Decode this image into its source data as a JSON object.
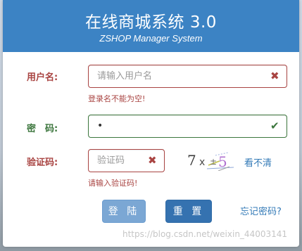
{
  "header": {
    "title": "在线商城系统 3.0",
    "subtitle": "ZSHOP Manager System"
  },
  "form": {
    "username": {
      "label": "用户名:",
      "placeholder": "请输入用户名",
      "value": "",
      "status": "error",
      "icon": "close-icon",
      "error_text": "登录名不能为空!"
    },
    "password": {
      "label": "密　码:",
      "placeholder": "",
      "value": "•",
      "status": "success",
      "icon": "check-icon"
    },
    "captcha": {
      "label": "验证码:",
      "placeholder": "验证码",
      "value": "",
      "status": "error",
      "icon": "close-icon",
      "error_text": "请输入验证码!",
      "refresh_link": "看不清"
    }
  },
  "buttons": {
    "login": "登 陆",
    "reset": "重 置",
    "forgot": "忘记密码?"
  },
  "watermark": "https://blog.csdn.net/weixin_44003141",
  "colors": {
    "header_bg": "#3c83c4",
    "error": "#a94442",
    "success": "#3c763d",
    "link": "#337ab7",
    "login_btn": "#7ba7d4",
    "reset_btn": "#3572b0"
  }
}
